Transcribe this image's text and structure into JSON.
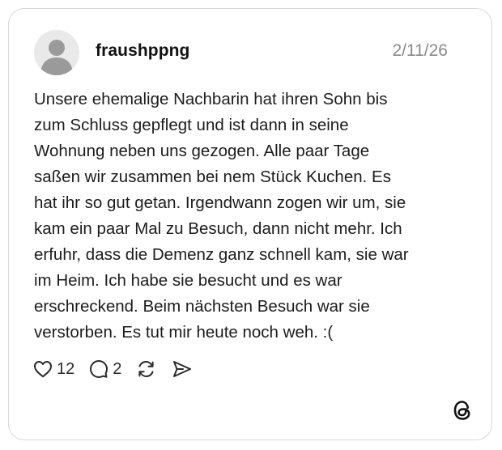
{
  "post": {
    "username": "fraushppng",
    "date": "2/11/26",
    "text": "Unsere ehemalige Nachbarin hat ihren Sohn bis\nzum Schluss gepflegt und ist dann in seine\nWohnung neben uns gezogen. Alle paar Tage\nsaßen wir zusammen bei nem Stück Kuchen. Es\nhat ihr so gut getan. Irgendwann zogen wir um, sie\nkam ein paar Mal zu Besuch, dann nicht mehr. Ich\nerfuhr, dass die Demenz ganz schnell kam, sie war\nim Heim. Ich habe sie besucht und es war\nerschreckend. Beim nächsten Besuch war sie\nverstorben. Es tut mir heute noch weh. :("
  },
  "actions": {
    "like_count": "12",
    "reply_count": "2",
    "like_icon": "heart-icon",
    "reply_icon": "speech-bubble-icon",
    "repost_icon": "repost-icon",
    "share_icon": "send-icon"
  },
  "branding": {
    "logo": "threads-logo-icon"
  },
  "colors": {
    "text": "#1c1c1c",
    "muted": "#8a8a8a",
    "border": "#d9d9d9",
    "avatar_bg": "#e9e9e9",
    "avatar_fg": "#999999"
  }
}
